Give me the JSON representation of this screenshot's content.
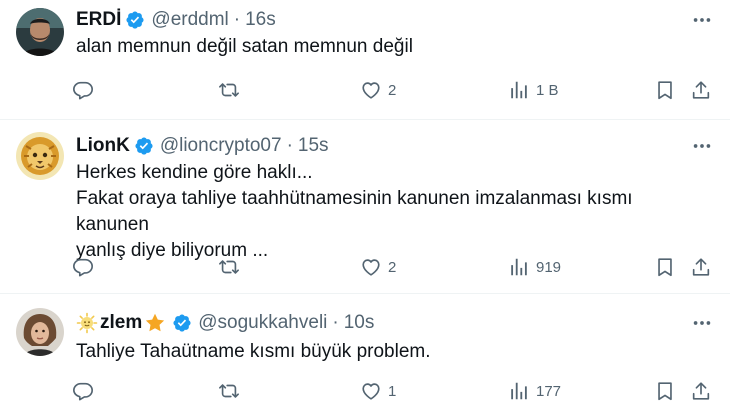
{
  "tweets": [
    {
      "name": "ERDİ",
      "handle": "@erddml",
      "time": "16s",
      "lines": [
        "alan memnun değil satan memnun değil"
      ],
      "likes": "2",
      "views": "1 B",
      "replies": "",
      "retweets": ""
    },
    {
      "name": "LionK",
      "handle": "@lioncrypto07",
      "time": "15s",
      "lines": [
        "Herkes kendine göre haklı...",
        "Fakat oraya tahliye taahhütnamesinin kanunen imzalanması kısmı kanunen",
        "yanlış diye biliyorum ..."
      ],
      "likes": "2",
      "views": "919",
      "replies": "",
      "retweets": ""
    },
    {
      "name": "zlem",
      "handle": "@sogukkahveli",
      "time": "10s",
      "lines": [
        "Tahliye Tahaütname kısmı büyük problem."
      ],
      "likes": "1",
      "views": "177",
      "replies": "",
      "retweets": ""
    }
  ],
  "ui": {
    "separator": "·"
  },
  "colors": {
    "verified": "#1d9bf0",
    "muted": "#536471",
    "text": "#0f1419",
    "divider": "#eff3f4"
  },
  "icons": [
    "reply-icon",
    "retweet-icon",
    "like-icon",
    "views-icon",
    "bookmark-icon",
    "share-icon",
    "more-icon",
    "verified-badge-icon"
  ]
}
